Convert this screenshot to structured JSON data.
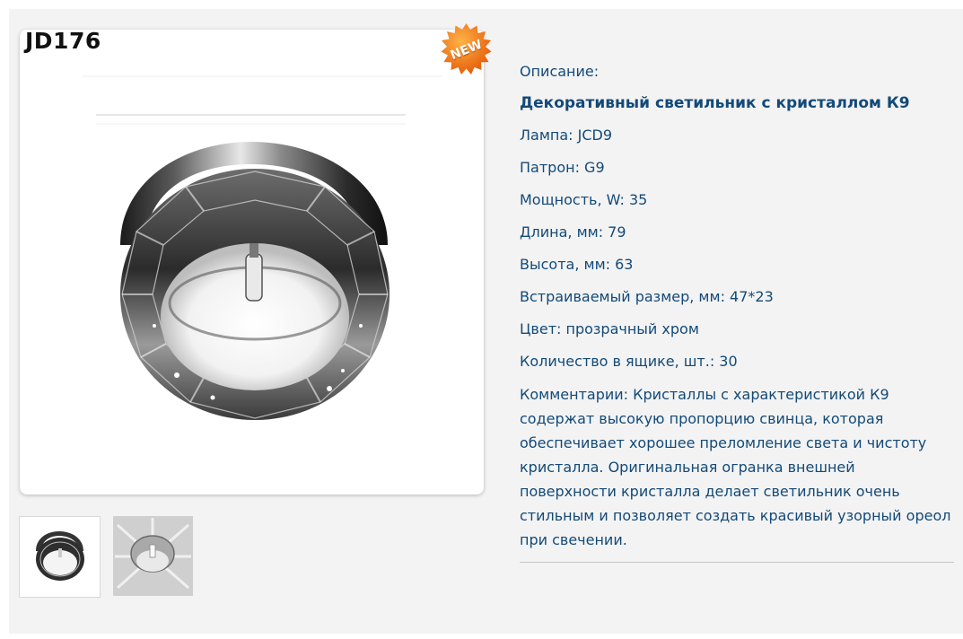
{
  "product": {
    "code": "JD176",
    "badge": "NEW"
  },
  "details": {
    "description_label": "Описание:",
    "title": "Декоративный светильник  с кристаллом К9",
    "lamp": "Лампа: JCD9",
    "socket": "Патрон: G9",
    "power": "Мощность, W: 35",
    "length": "Длина, мм: 79",
    "height": "Высота, мм: 63",
    "mount_size": "Встраиваемый размер, мм: 47*23",
    "color": "Цвет: прозрачный хром",
    "box_qty": "Количество в ящике, шт.: 30",
    "comment": "Комментарии: Кристаллы с характеристикой К9 содержат высокую пропорцию свинца, которая обеспечивает хорошее преломление света и чистоту кристалла. Оригинальная огранка внешней поверхности кристалла делает светильник очень стильным и позволяет создать красивый узорный ореол при свечении."
  },
  "thumbnails": [
    {
      "icon": "crystal-fixture-thumbnail"
    },
    {
      "icon": "crystal-fixture-lit-thumbnail"
    }
  ],
  "colors": {
    "panel": "#f3f3f3",
    "text_blue": "#134a78",
    "badge_orange": "#f07a1a"
  }
}
